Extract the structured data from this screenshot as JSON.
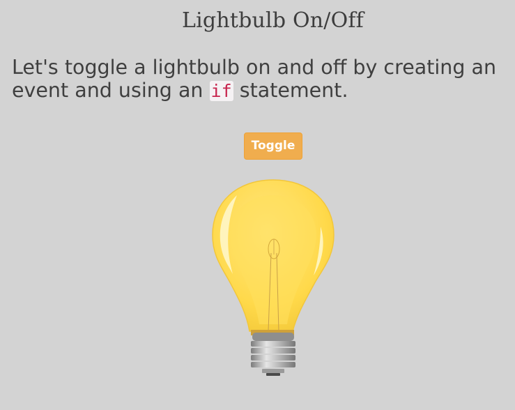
{
  "page": {
    "title": "Lightbulb On/Off",
    "intro_before": "Let's toggle a lightbulb on and off by creating an event and using an ",
    "intro_code": "if",
    "intro_after": " statement."
  },
  "toggle_button": {
    "label": "Toggle"
  },
  "bulb": {
    "state": "on",
    "glass_color": "#ffdc55",
    "glow_color": "#fff2a0",
    "base_color": "#a8a8a8"
  }
}
